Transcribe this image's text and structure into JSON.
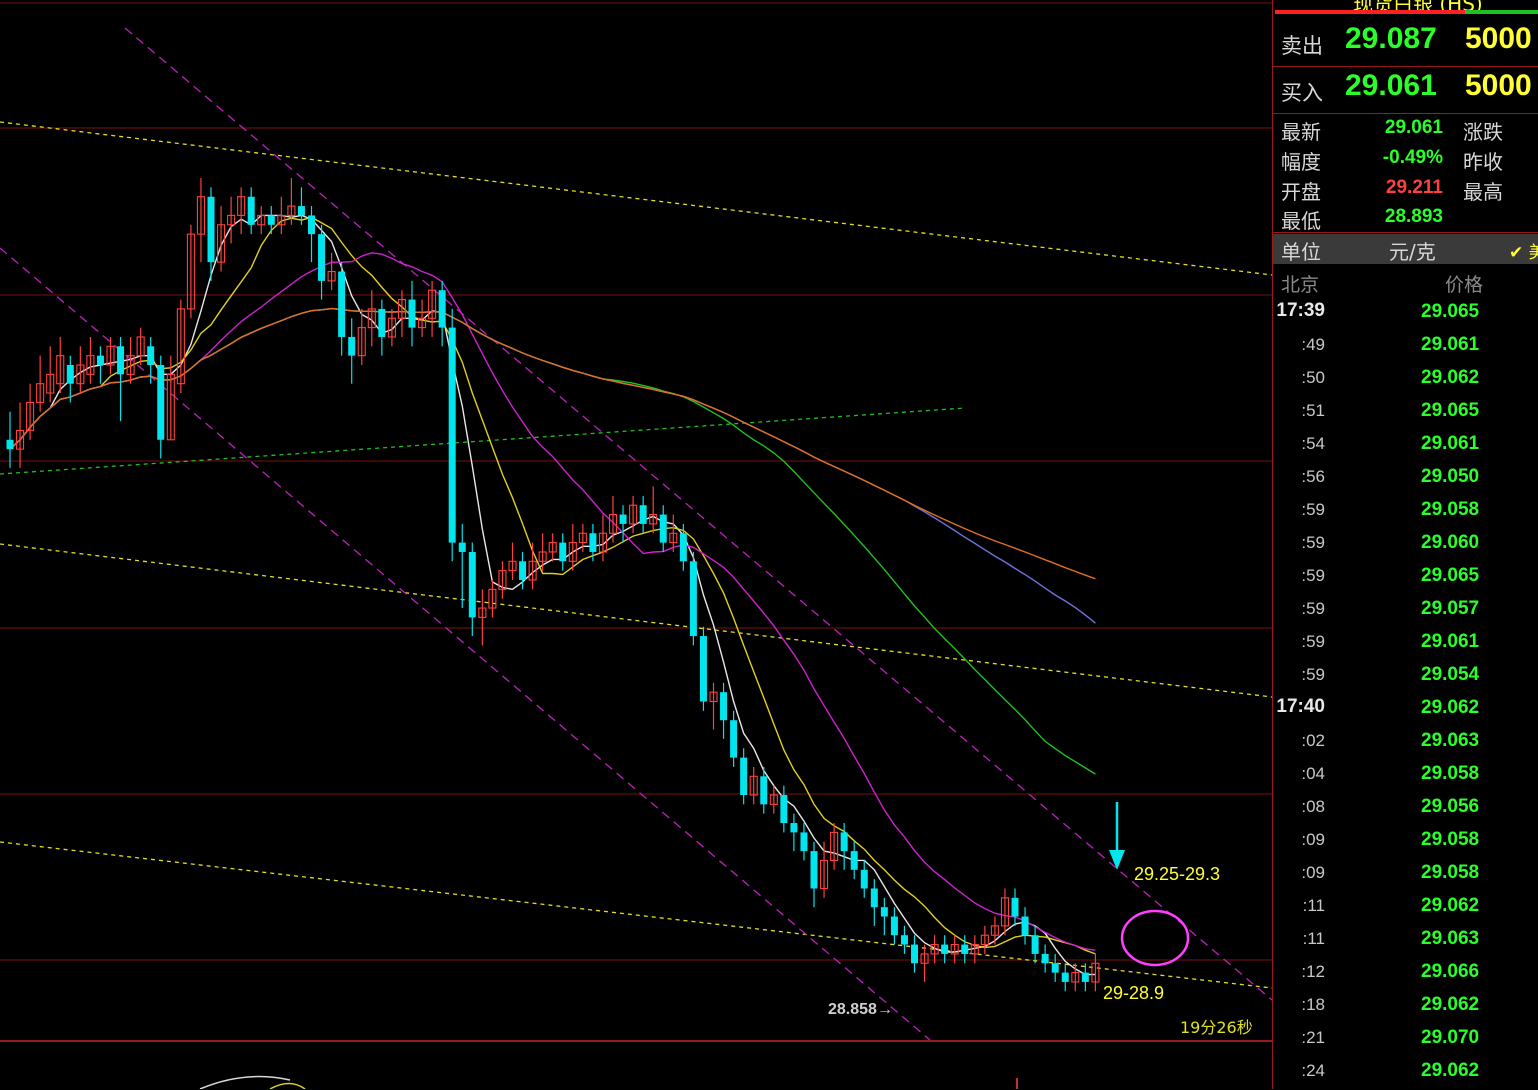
{
  "colors": {
    "up": "#ff4040",
    "down": "#00e5ee",
    "ma_white": "#e8e8e8",
    "ma_yellow": "#e0d020",
    "ma_magenta": "#d020d0",
    "ma_green": "#20c020",
    "ma_blue": "#7070e0",
    "ma_orange": "#e07020",
    "channel": "#c020c0",
    "support": "#e0e020"
  },
  "chart_data": {
    "type": "candlestick",
    "symbol_title": "现货白银 (HS)",
    "ylim": [
      28.8,
      29.72
    ],
    "candles": [
      [
        29.41,
        29.4,
        29.44,
        29.38
      ],
      [
        29.4,
        29.42,
        29.45,
        29.38
      ],
      [
        29.42,
        29.45,
        29.47,
        29.41
      ],
      [
        29.45,
        29.47,
        29.5,
        29.44
      ],
      [
        29.46,
        29.48,
        29.51,
        29.45
      ],
      [
        29.47,
        29.5,
        29.52,
        29.46
      ],
      [
        29.49,
        29.47,
        29.5,
        29.45
      ],
      [
        29.47,
        29.49,
        29.51,
        29.46
      ],
      [
        29.48,
        29.5,
        29.52,
        29.47
      ],
      [
        29.5,
        29.49,
        29.51,
        29.47
      ],
      [
        29.49,
        29.51,
        29.52,
        29.48
      ],
      [
        29.51,
        29.48,
        29.52,
        29.43
      ],
      [
        29.48,
        29.5,
        29.52,
        29.47
      ],
      [
        29.5,
        29.52,
        29.53,
        29.49
      ],
      [
        29.51,
        29.49,
        29.52,
        29.47
      ],
      [
        29.49,
        29.41,
        29.5,
        29.39
      ],
      [
        29.41,
        29.48,
        29.5,
        29.41
      ],
      [
        29.47,
        29.55,
        29.56,
        29.46
      ],
      [
        29.55,
        29.63,
        29.64,
        29.54
      ],
      [
        29.63,
        29.67,
        29.69,
        29.6
      ],
      [
        29.67,
        29.6,
        29.68,
        29.58
      ],
      [
        29.6,
        29.64,
        29.66,
        29.59
      ],
      [
        29.64,
        29.65,
        29.67,
        29.62
      ],
      [
        29.65,
        29.67,
        29.68,
        29.63
      ],
      [
        29.67,
        29.64,
        29.68,
        29.63
      ],
      [
        29.64,
        29.65,
        29.66,
        29.63
      ],
      [
        29.65,
        29.64,
        29.66,
        29.63
      ],
      [
        29.64,
        29.65,
        29.67,
        29.63
      ],
      [
        29.65,
        29.66,
        29.69,
        29.64
      ],
      [
        29.66,
        29.65,
        29.68,
        29.64
      ],
      [
        29.65,
        29.63,
        29.66,
        29.6
      ],
      [
        29.63,
        29.58,
        29.64,
        29.56
      ],
      [
        29.58,
        29.59,
        29.61,
        29.57
      ],
      [
        29.59,
        29.52,
        29.6,
        29.5
      ],
      [
        29.52,
        29.5,
        29.54,
        29.47
      ],
      [
        29.5,
        29.53,
        29.55,
        29.49
      ],
      [
        29.53,
        29.55,
        29.57,
        29.51
      ],
      [
        29.55,
        29.52,
        29.56,
        29.5
      ],
      [
        29.52,
        29.54,
        29.55,
        29.51
      ],
      [
        29.54,
        29.56,
        29.57,
        29.52
      ],
      [
        29.56,
        29.53,
        29.58,
        29.51
      ],
      [
        29.53,
        29.54,
        29.56,
        29.52
      ],
      [
        29.54,
        29.57,
        29.58,
        29.52
      ],
      [
        29.57,
        29.53,
        29.58,
        29.51
      ],
      [
        29.53,
        29.3,
        29.55,
        29.28
      ],
      [
        29.3,
        29.29,
        29.32,
        29.23
      ],
      [
        29.29,
        29.22,
        29.3,
        29.2
      ],
      [
        29.22,
        29.23,
        29.25,
        29.19
      ],
      [
        29.23,
        29.25,
        29.26,
        29.22
      ],
      [
        29.25,
        29.27,
        29.28,
        29.24
      ],
      [
        29.27,
        29.28,
        29.3,
        29.26
      ],
      [
        29.28,
        29.26,
        29.29,
        29.25
      ],
      [
        29.26,
        29.28,
        29.3,
        29.25
      ],
      [
        29.28,
        29.29,
        29.31,
        29.27
      ],
      [
        29.29,
        29.3,
        29.31,
        29.28
      ],
      [
        29.3,
        29.28,
        29.31,
        29.27
      ],
      [
        29.28,
        29.3,
        29.32,
        29.27
      ],
      [
        29.3,
        29.31,
        29.32,
        29.29
      ],
      [
        29.31,
        29.29,
        29.32,
        29.28
      ],
      [
        29.29,
        29.31,
        29.33,
        29.28
      ],
      [
        29.31,
        29.33,
        29.35,
        29.3
      ],
      [
        29.33,
        29.32,
        29.34,
        29.3
      ],
      [
        29.32,
        29.34,
        29.35,
        29.31
      ],
      [
        29.34,
        29.32,
        29.35,
        29.31
      ],
      [
        29.32,
        29.33,
        29.36,
        29.31
      ],
      [
        29.33,
        29.3,
        29.34,
        29.29
      ],
      [
        29.3,
        29.31,
        29.33,
        29.29
      ],
      [
        29.31,
        29.28,
        29.32,
        29.27
      ],
      [
        29.28,
        29.2,
        29.29,
        29.19
      ],
      [
        29.2,
        29.13,
        29.21,
        29.12
      ],
      [
        29.13,
        29.14,
        29.15,
        29.1
      ],
      [
        29.14,
        29.11,
        29.15,
        29.09
      ],
      [
        29.11,
        29.07,
        29.12,
        29.06
      ],
      [
        29.07,
        29.03,
        29.08,
        29.02
      ],
      [
        29.03,
        29.05,
        29.06,
        29.02
      ],
      [
        29.05,
        29.02,
        29.06,
        29.01
      ],
      [
        29.02,
        29.03,
        29.04,
        29.01
      ],
      [
        29.03,
        29.0,
        29.04,
        28.99
      ],
      [
        29.0,
        28.99,
        29.01,
        28.97
      ],
      [
        28.99,
        28.97,
        29.0,
        28.96
      ],
      [
        28.97,
        28.93,
        28.98,
        28.91
      ],
      [
        28.93,
        28.96,
        28.98,
        28.92
      ],
      [
        28.96,
        28.99,
        29.0,
        28.95
      ],
      [
        28.99,
        28.97,
        29.0,
        28.95
      ],
      [
        28.97,
        28.95,
        28.98,
        28.94
      ],
      [
        28.95,
        28.93,
        28.96,
        28.92
      ],
      [
        28.93,
        28.91,
        28.94,
        28.89
      ],
      [
        28.91,
        28.9,
        28.92,
        28.88
      ],
      [
        28.9,
        28.88,
        28.91,
        28.87
      ],
      [
        28.88,
        28.87,
        28.89,
        28.86
      ],
      [
        28.87,
        28.85,
        28.88,
        28.84
      ],
      [
        28.85,
        28.86,
        28.87,
        28.83
      ],
      [
        28.86,
        28.87,
        28.88,
        28.85
      ],
      [
        28.87,
        28.86,
        28.88,
        28.85
      ],
      [
        28.86,
        28.87,
        28.88,
        28.85
      ],
      [
        28.87,
        28.86,
        28.88,
        28.85
      ],
      [
        28.86,
        28.87,
        28.88,
        28.85
      ],
      [
        28.87,
        28.88,
        28.89,
        28.86
      ],
      [
        28.88,
        28.89,
        28.9,
        28.87
      ],
      [
        28.89,
        28.92,
        28.93,
        28.88
      ],
      [
        28.92,
        28.9,
        28.93,
        28.89
      ],
      [
        28.9,
        28.88,
        28.91,
        28.87
      ],
      [
        28.88,
        28.86,
        28.89,
        28.85
      ],
      [
        28.86,
        28.85,
        28.87,
        28.84
      ],
      [
        28.85,
        28.84,
        28.86,
        28.83
      ],
      [
        28.84,
        28.83,
        28.85,
        28.82
      ],
      [
        28.83,
        28.84,
        28.85,
        28.82
      ],
      [
        28.84,
        28.83,
        28.85,
        28.82
      ],
      [
        28.83,
        28.85,
        28.86,
        28.82
      ]
    ],
    "price_labels": [
      {
        "text": "28.858→"
      },
      {
        "text": "29.25-29.3"
      },
      {
        "text": "29-28.9"
      },
      {
        "text": "19分26秒"
      }
    ]
  },
  "panel": {
    "sell_label": "卖出",
    "sell_price": "29.087",
    "sell_vol": "5000",
    "buy_label": "买入",
    "buy_price": "29.061",
    "buy_vol": "5000",
    "stats": [
      {
        "label": "最新",
        "value": "29.061",
        "color": "#2aff2a",
        "label2": "涨跌"
      },
      {
        "label": "幅度",
        "value": "-0.49%",
        "color": "#2aff2a",
        "label2": "昨收"
      },
      {
        "label": "开盘",
        "value": "29.211",
        "color": "#ff4040",
        "label2": "最高"
      },
      {
        "label": "最低",
        "value": "28.893",
        "color": "#2aff2a",
        "label2": ""
      }
    ],
    "unit_label": "单位",
    "unit_value": "元/克",
    "unit_check": "✔ 美",
    "ticks_head_left": "北京",
    "ticks_head_right": "价格",
    "ticks": [
      {
        "t": "17:39",
        "p": "29.065",
        "major": true
      },
      {
        "t": ":49",
        "p": "29.061"
      },
      {
        "t": ":50",
        "p": "29.062"
      },
      {
        "t": ":51",
        "p": "29.065"
      },
      {
        "t": ":54",
        "p": "29.061"
      },
      {
        "t": ":56",
        "p": "29.050"
      },
      {
        "t": ":59",
        "p": "29.058"
      },
      {
        "t": ":59",
        "p": "29.060"
      },
      {
        "t": ":59",
        "p": "29.065"
      },
      {
        "t": ":59",
        "p": "29.057"
      },
      {
        "t": ":59",
        "p": "29.061"
      },
      {
        "t": ":59",
        "p": "29.054"
      },
      {
        "t": "17:40",
        "p": "29.062",
        "major": true
      },
      {
        "t": ":02",
        "p": "29.063"
      },
      {
        "t": ":04",
        "p": "29.058"
      },
      {
        "t": ":08",
        "p": "29.056"
      },
      {
        "t": ":09",
        "p": "29.058"
      },
      {
        "t": ":09",
        "p": "29.058"
      },
      {
        "t": ":11",
        "p": "29.062"
      },
      {
        "t": ":11",
        "p": "29.063"
      },
      {
        "t": ":12",
        "p": "29.066"
      },
      {
        "t": ":18",
        "p": "29.062"
      },
      {
        "t": ":21",
        "p": "29.070"
      },
      {
        "t": ":24",
        "p": "29.062"
      }
    ]
  }
}
